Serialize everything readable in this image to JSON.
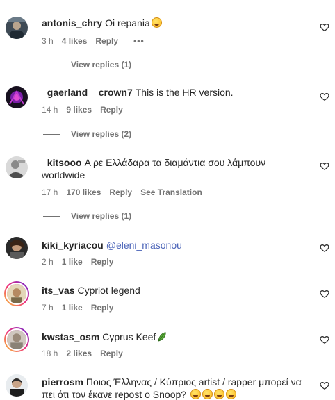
{
  "comments": [
    {
      "username": "antonis_chry",
      "text": "Oi repania",
      "time": "3 h",
      "likes": "4 likes",
      "reply": "Reply",
      "more": "•••",
      "view_replies": "View replies (1)",
      "emoji": "rolling-on-floor-laughing"
    },
    {
      "username": "_gaerland__crown7",
      "text": "This is the HR version.",
      "time": "14 h",
      "likes": "9 likes",
      "reply": "Reply",
      "view_replies": "View replies (2)"
    },
    {
      "username": "_kitsooo",
      "text": "Α ρε Ελλάδαρα τα διαμάντια σου λάμπουν",
      "text2": "worldwide",
      "time": "17 h",
      "likes": "170 likes",
      "reply": "Reply",
      "translation": "See Translation",
      "view_replies": "View replies (1)"
    },
    {
      "username": "kiki_kyriacou",
      "mention": "@eleni_masonou",
      "time": "2 h",
      "likes": "1 like",
      "reply": "Reply"
    },
    {
      "username": "its_vas",
      "text": "Cypriot legend",
      "time": "7 h",
      "likes": "1 like",
      "reply": "Reply"
    },
    {
      "username": "kwstas_osm",
      "text": "Cyprus Keef",
      "time": "18 h",
      "likes": "2 likes",
      "reply": "Reply",
      "emoji": "herb"
    },
    {
      "username": "pierrosm",
      "text": "Ποιος Έλληνας / Κύπριος artist / rapper μπορεί να",
      "text2": "πει ότι τον έκανε repost ο Snoop?",
      "emoji": "rolling-on-floor-laughing x4"
    }
  ]
}
